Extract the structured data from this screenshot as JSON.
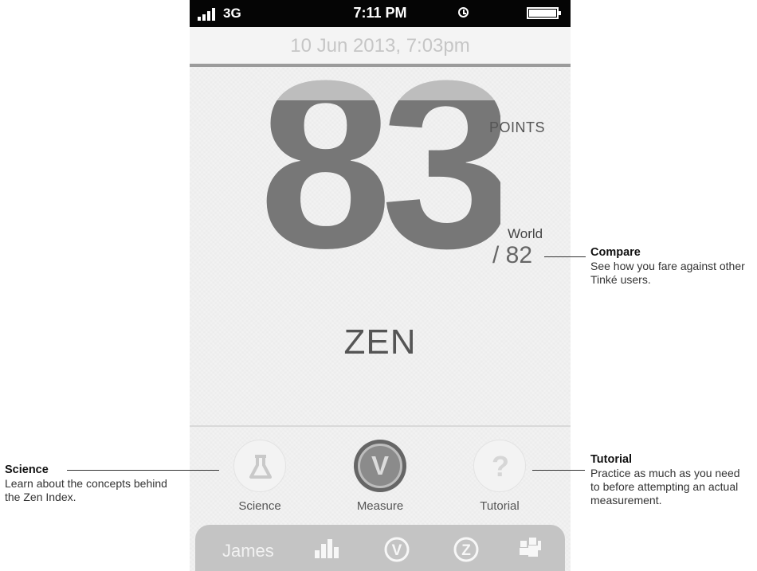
{
  "status_bar": {
    "carrier": "3G",
    "time": "7:11 PM"
  },
  "header": {
    "date": "10 Jun 2013, 7:03pm"
  },
  "score": {
    "value": "83",
    "unit": "POINTS",
    "world_label": "World",
    "world_value": "/ 82",
    "state": "ZEN"
  },
  "actions": {
    "science_label": "Science",
    "measure_label": "Measure",
    "measure_letter": "V",
    "tutorial_label": "Tutorial",
    "tutorial_symbol": "?"
  },
  "tab_bar": {
    "user": "James",
    "v_letter": "V",
    "z_letter": "Z"
  },
  "annotations": {
    "compare": {
      "title": "Compare",
      "text": "See how you fare against other Tinké users."
    },
    "science": {
      "title": "Science",
      "text": "Learn about the concepts behind the Zen Index."
    },
    "tutorial": {
      "title": "Tutorial",
      "text": "Practice as much as you need to before attempting an actual measurement."
    }
  },
  "colors": {
    "status_bar": "#050505",
    "digits": "#777777",
    "digits_top": "#bdbdbd",
    "tab_bar": "#c4c4c4"
  },
  "icons": [
    "signal-icon",
    "alarm-icon",
    "battery-icon",
    "flask-icon",
    "measure-icon",
    "question-icon",
    "bar-chart-icon",
    "v-circle-icon",
    "z-circle-icon",
    "people-icon"
  ]
}
